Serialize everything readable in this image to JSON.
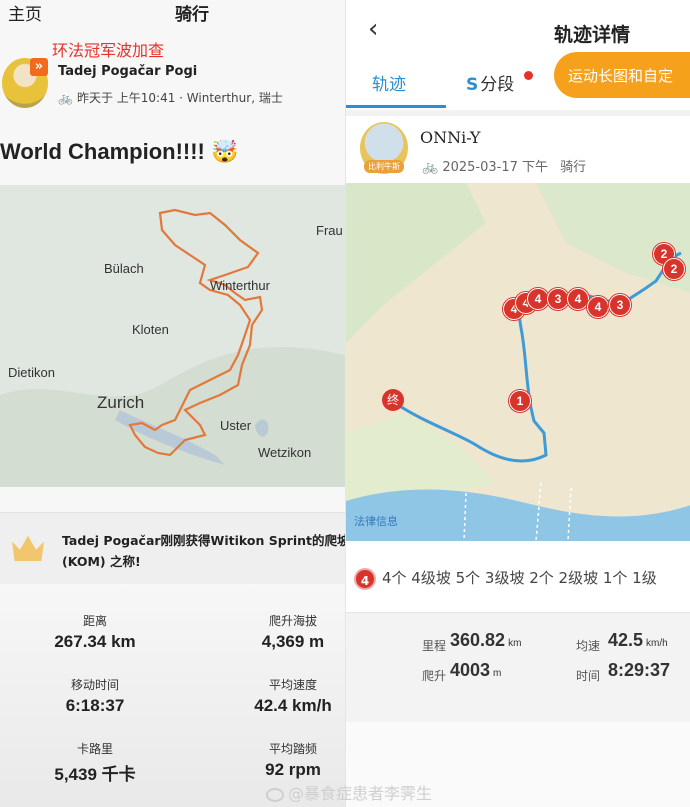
{
  "left": {
    "header": {
      "home": "主页",
      "ride": "骑行"
    },
    "headline": "环法冠军波加查",
    "user": {
      "name": "Tadej Pogačar Pogi",
      "meta": "昨天于 上午10:41 · Winterthur, 瑞士"
    },
    "activity_title": "World Champion!!!! 🤯",
    "map": {
      "labels": [
        "Frau",
        "Bülach",
        "Winterthur",
        "Kloten",
        "Dietikon",
        "Zurich",
        "Uster",
        "Wetzikon"
      ]
    },
    "kom": {
      "line1": "Tadej Pogačar刚刚获得Witikon Sprint的爬坡",
      "line2": "(KOM) 之称!"
    },
    "stats": [
      {
        "label": "距离",
        "value": "267.34 km"
      },
      {
        "label": "爬升海拔",
        "value": "4,369 m"
      },
      {
        "label": "移动时间",
        "value": "6:18:37"
      },
      {
        "label": "平均速度",
        "value": "42.4 km/h"
      },
      {
        "label": "卡路里",
        "value": "5,439 千卡"
      },
      {
        "label": "平均踏频",
        "value": "92 rpm"
      }
    ]
  },
  "right": {
    "header": {
      "back": "‹",
      "title": "轨迹详情"
    },
    "tabs": {
      "track": "轨迹",
      "segments": "分段"
    },
    "promo_button": "运动长图和自定",
    "user": {
      "badge": "比利牛斯",
      "name": "ONNi-Y",
      "date": "2025-03-17 下午",
      "type": "骑行"
    },
    "map": {
      "legal": "法律信息",
      "end_marker": "终",
      "markers": [
        "1",
        "4",
        "4",
        "4",
        "3",
        "4",
        "4",
        "3",
        "2",
        "2"
      ]
    },
    "climbs": {
      "icon": "4",
      "text": "4个 4级坡 5个 3级坡 2个 2级坡 1个 1级"
    },
    "stats": {
      "mileage_label": "里程",
      "mileage": "360.82",
      "mileage_unit": "km",
      "avg_speed_label": "均速",
      "avg_speed": "42.5",
      "avg_speed_unit": "km/h",
      "climb_label": "爬升",
      "climb": "4003",
      "climb_unit": "m",
      "time_label": "时间",
      "time": "8:29:37"
    }
  },
  "watermark": "@暴食症患者李霁生",
  "colors": {
    "strava_orange": "#f26a1b",
    "track_blue": "#2a8fd4",
    "promo_orange": "#f5a11b",
    "marker_red": "#d9342b"
  }
}
